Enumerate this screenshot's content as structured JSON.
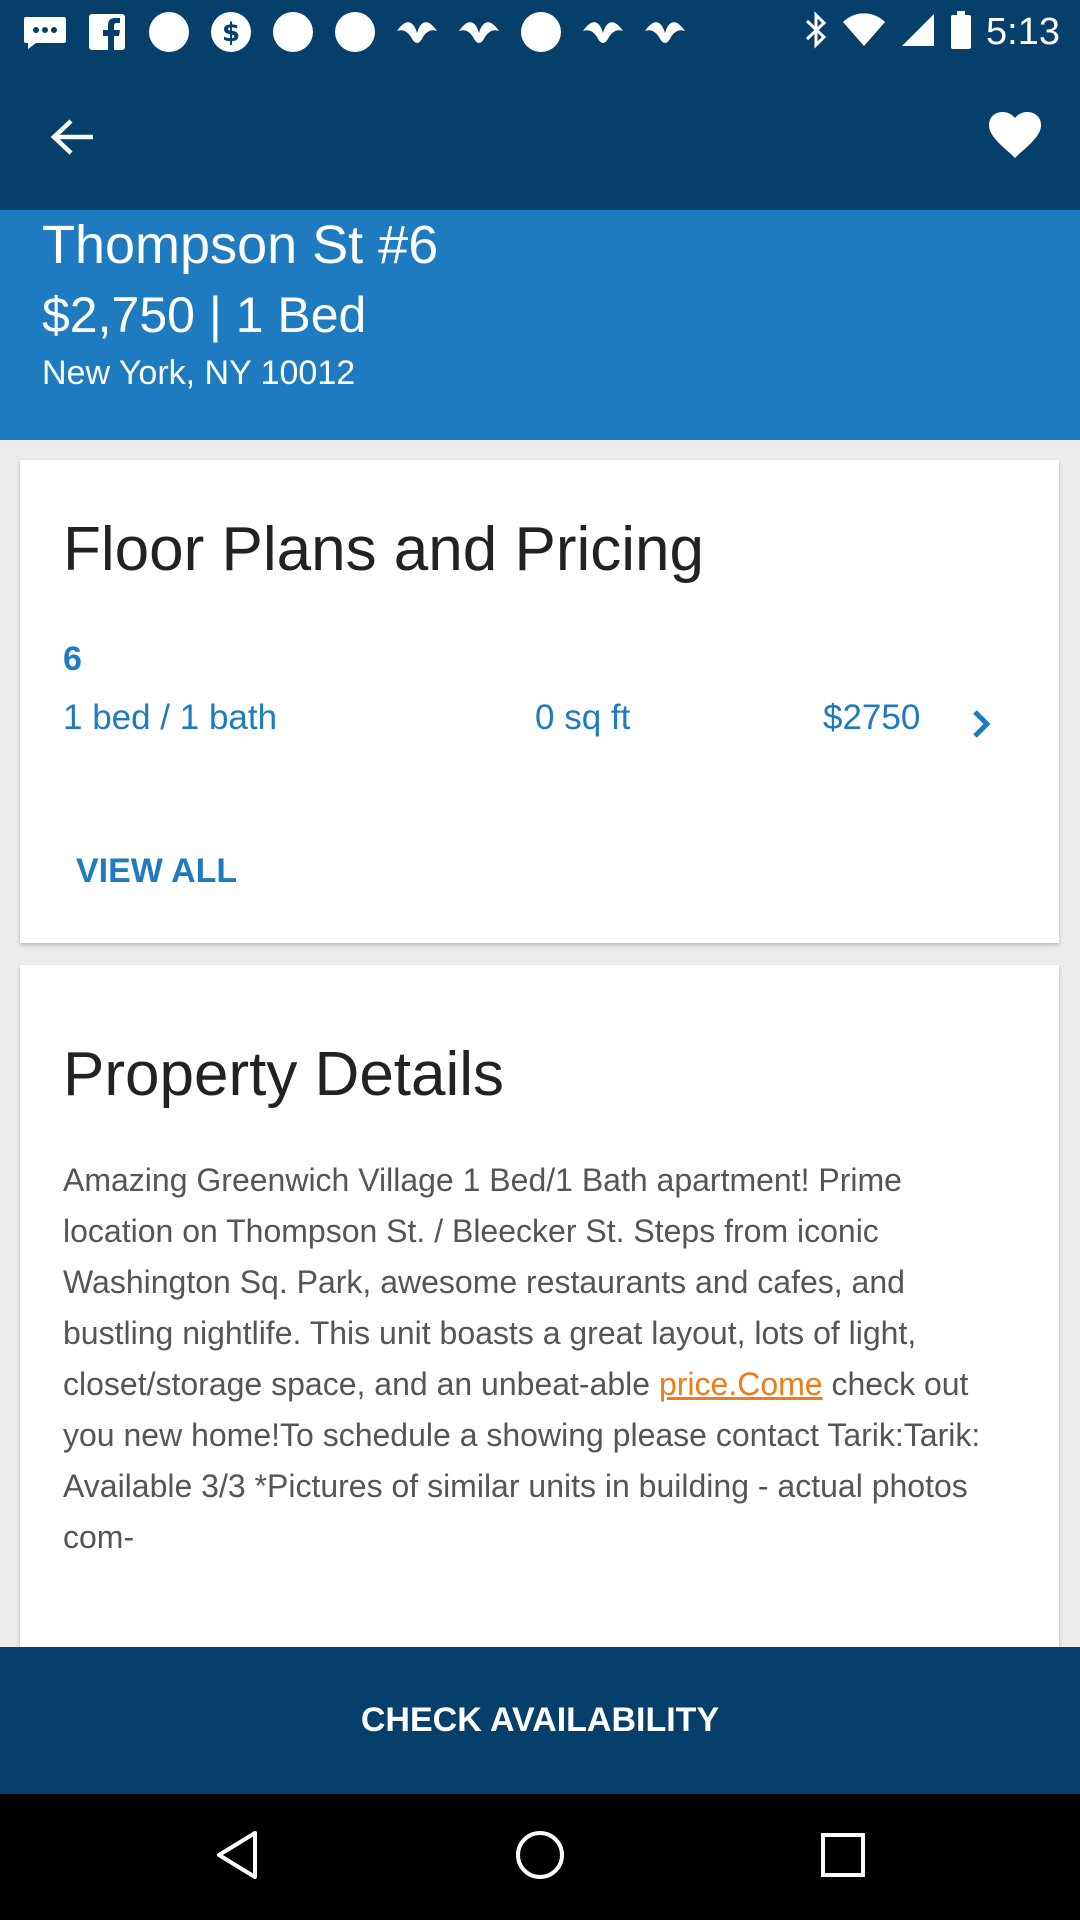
{
  "status_bar": {
    "time": "5:13",
    "notification_icons": [
      "messages-icon",
      "facebook-icon",
      "notification-dot-icon",
      "currency-app-icon",
      "notification-dot-icon",
      "notification-dot-icon",
      "bird-app-icon",
      "bird-app-icon",
      "notification-dot-icon",
      "bird-app-icon",
      "bird-app-icon"
    ],
    "system_icons": [
      "bluetooth-icon",
      "wifi-icon",
      "signal-icon",
      "battery-icon"
    ]
  },
  "app_bar": {
    "back_icon": "arrow-left-icon",
    "favorite_icon": "heart-icon"
  },
  "listing": {
    "title": "Thompson St #6",
    "price_beds": "$2,750 | 1 Bed",
    "address": "New York, NY 10012"
  },
  "floor_plans": {
    "heading": "Floor Plans and Pricing",
    "plans": [
      {
        "name": "6",
        "beds_baths": "1 bed / 1 bath",
        "sqft": "0 sq ft",
        "price": "$2750"
      }
    ],
    "view_all_label": "VIEW ALL"
  },
  "property_details": {
    "heading": "Property Details",
    "description_before_link": "Amazing Greenwich Village 1 Bed/1 Bath apartment! Prime location on Thompson St. / Bleecker St. Steps from iconic Washington Sq. Park, awesome restaurants and cafes, and bustling nightlife. This unit boasts a great layout, lots of light, closet/storage space, and an unbeat-able ",
    "description_link": "price.Come",
    "description_after_link": " check out you new home!To schedule a showing please contact Tarik:Tarik: Available 3/3 *Pictures of similar units in building - actual photos com-"
  },
  "actions": {
    "check_availability_label": "CHECK AVAILABILITY"
  },
  "colors": {
    "app_bar": "#073f6b",
    "hero": "#1e7bbf",
    "accent_text": "#1e7bbf",
    "link": "#f07b1a"
  }
}
